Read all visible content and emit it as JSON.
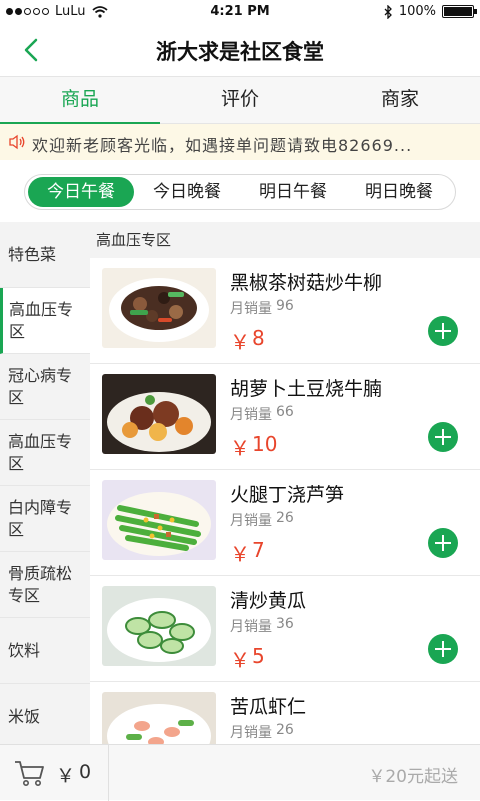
{
  "status_bar": {
    "carrier": "LuLu",
    "time": "4:21 PM",
    "battery": "100%"
  },
  "header": {
    "title": "浙大求是社区食堂"
  },
  "tabs": [
    {
      "label": "商品"
    },
    {
      "label": "评价"
    },
    {
      "label": "商家"
    }
  ],
  "notice": {
    "text": "欢迎新老顾客光临，如遇接单问题请致电82669..."
  },
  "meals": [
    {
      "label": "今日午餐"
    },
    {
      "label": "今日晚餐"
    },
    {
      "label": "明日午餐"
    },
    {
      "label": "明日晚餐"
    }
  ],
  "sidebar": [
    {
      "label": "特色菜"
    },
    {
      "label": "高血压专区"
    },
    {
      "label": "冠心病专区"
    },
    {
      "label": "高血压专区"
    },
    {
      "label": "白内障专区"
    },
    {
      "label": "骨质疏松专区"
    },
    {
      "label": "饮料"
    },
    {
      "label": "米饭"
    }
  ],
  "section": {
    "title": "高血压专区"
  },
  "products": [
    {
      "name": "黑椒茶树菇炒牛柳",
      "sales_label": "月销量",
      "sales": "96",
      "currency": "￥",
      "price": "8"
    },
    {
      "name": "胡萝卜土豆烧牛腩",
      "sales_label": "月销量",
      "sales": "66",
      "currency": "￥",
      "price": "10"
    },
    {
      "name": "火腿丁浇芦笋",
      "sales_label": "月销量",
      "sales": "26",
      "currency": "￥",
      "price": "7"
    },
    {
      "name": "清炒黄瓜",
      "sales_label": "月销量",
      "sales": "36",
      "currency": "￥",
      "price": "5"
    },
    {
      "name": "苦瓜虾仁",
      "sales_label": "月销量",
      "sales": "26",
      "currency": "￥",
      "price": ""
    }
  ],
  "cart": {
    "currency": "￥",
    "total": "0",
    "min_order": "￥20元起送"
  },
  "colors": {
    "accent": "#1aa653",
    "price": "#e8452c",
    "notice_bg": "#fdf8e6"
  }
}
